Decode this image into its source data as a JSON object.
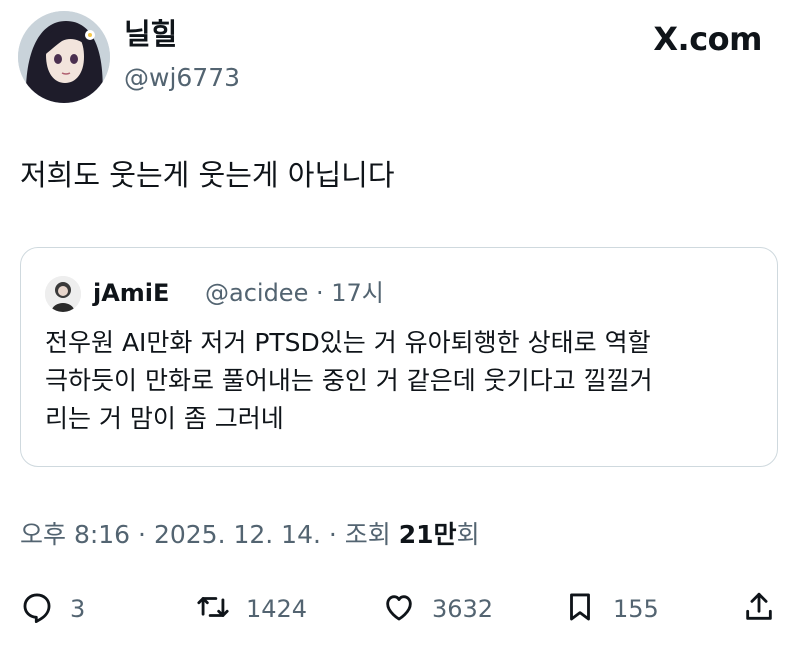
{
  "author": {
    "name": "닐힐",
    "handle": "@wj6773"
  },
  "site": {
    "label": "X.com"
  },
  "tweet": {
    "text": "저희도 웃는게 웃는게 아닙니다"
  },
  "quote": {
    "name": "jAmiE",
    "handle_time": "@acidee · 17시",
    "lines": [
      "전우원 AI만화 저거 PTSD있는 거 유아퇴행한 상태로 역할",
      "극하듯이 만화로 풀어내는 중인 거 같은데 웃기다고 낄낄거",
      "리는 거 맘이 좀 그러네"
    ]
  },
  "meta": {
    "time": "오후 8:16",
    "date": "2025. 12. 14.",
    "views_label": "조회",
    "views_value": "21만",
    "views_suffix": "회"
  },
  "actions": {
    "reply_count": "3",
    "retweet_count": "1424",
    "like_count": "3632",
    "bookmark_count": "155"
  },
  "icons": [
    "reply-icon",
    "retweet-icon",
    "like-icon",
    "bookmark-icon",
    "share-icon"
  ],
  "colors": {
    "text": "#0f1419",
    "secondary": "#536471",
    "border": "#cfd9de"
  }
}
